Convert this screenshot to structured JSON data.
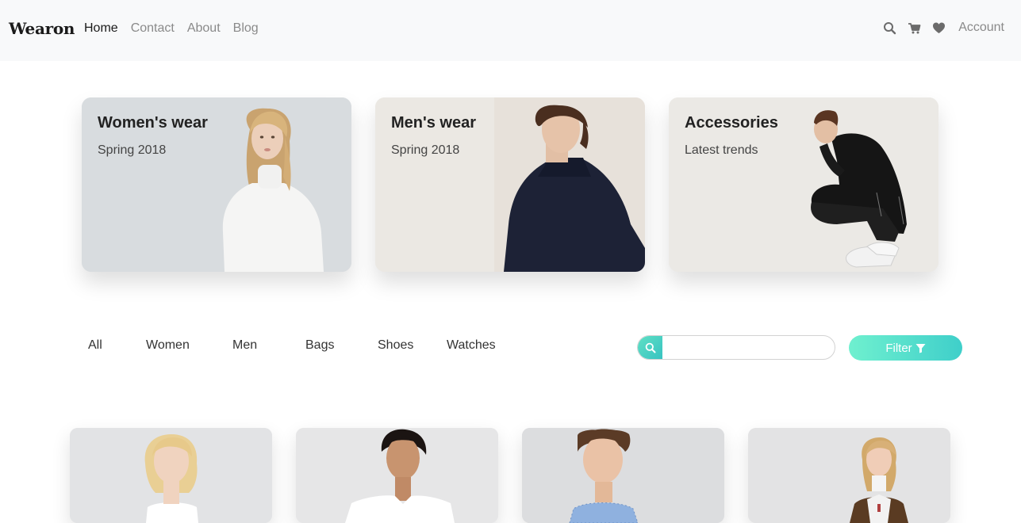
{
  "navbar": {
    "brand": "Wearon",
    "links": [
      "Home",
      "Contact",
      "About",
      "Blog"
    ],
    "icons": [
      "search-icon",
      "cart-icon",
      "heart-icon"
    ],
    "account": "Account"
  },
  "categories": [
    {
      "title": "Women's wear",
      "subtitle": "Spring 2018"
    },
    {
      "title": "Men's wear",
      "subtitle": "Spring 2018"
    },
    {
      "title": "Accessories",
      "subtitle": "Latest trends"
    }
  ],
  "filters": {
    "tabs": [
      "All",
      "Women",
      "Men",
      "Bags",
      "Shoes",
      "Watches"
    ],
    "search_placeholder": "",
    "search_value": "",
    "filter_label": "Filter"
  },
  "colors": {
    "accent_start": "#6ff0cf",
    "accent_end": "#3fcfca",
    "navbar_bg": "#f8f9fa"
  }
}
